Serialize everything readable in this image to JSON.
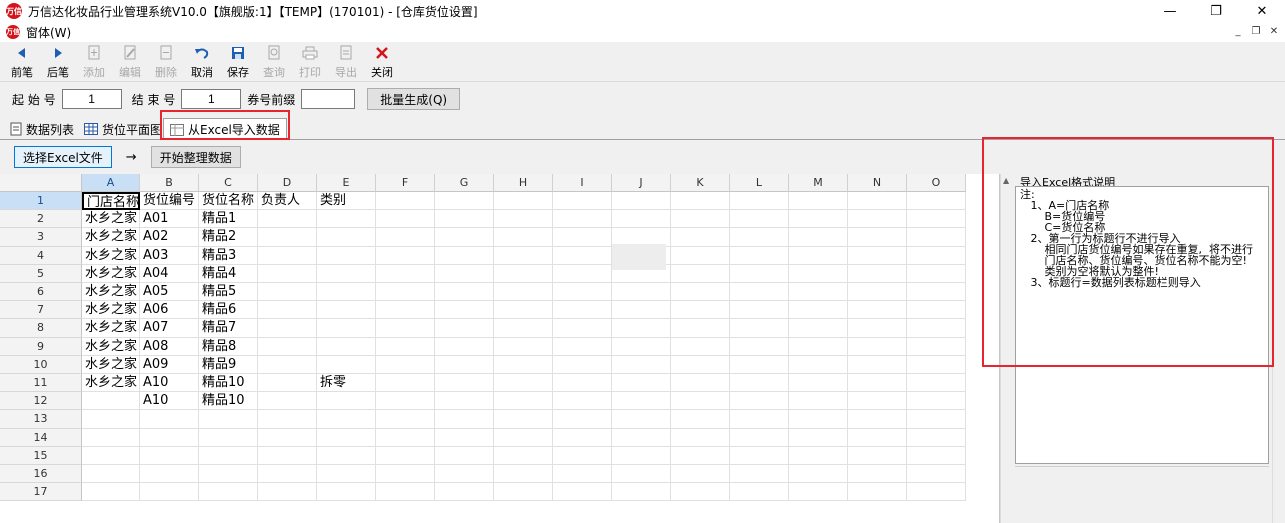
{
  "window": {
    "title": "万信达化妆品行业管理系统V10.0【旗舰版:1】【TEMP】(170101) - [仓库货位设置]",
    "logo": "万信",
    "controls": [
      "—",
      "❐",
      "✕"
    ]
  },
  "menubar": {
    "window_menu": "窗体(W)",
    "mdi_controls": [
      "_",
      "❐",
      "✕"
    ]
  },
  "toolbar": [
    {
      "label": "前笔",
      "icon": "arrow-up",
      "enabled": true
    },
    {
      "label": "后笔",
      "icon": "arrow-down",
      "enabled": true
    },
    {
      "label": "添加",
      "icon": "add-doc",
      "enabled": false
    },
    {
      "label": "编辑",
      "icon": "edit-doc",
      "enabled": false
    },
    {
      "label": "删除",
      "icon": "delete-doc",
      "enabled": false
    },
    {
      "label": "取消",
      "icon": "undo",
      "enabled": true
    },
    {
      "label": "保存",
      "icon": "save",
      "enabled": true
    },
    {
      "label": "查询",
      "icon": "query",
      "enabled": false
    },
    {
      "label": "打印",
      "icon": "print",
      "enabled": false
    },
    {
      "label": "导出",
      "icon": "export",
      "enabled": false
    },
    {
      "label": "关闭",
      "icon": "close",
      "enabled": true
    }
  ],
  "params": {
    "start_label": "起 始 号",
    "start_value": "1",
    "end_label": "结 束 号",
    "end_value": "1",
    "prefix_label": "券号前缀",
    "prefix_value": "",
    "generate_label": "批量生成(Q)"
  },
  "tabs": [
    {
      "label": "数据列表",
      "icon": "doc"
    },
    {
      "label": "货位平面图",
      "icon": "grid"
    },
    {
      "label": "从Excel导入数据",
      "icon": "excel",
      "active": true
    }
  ],
  "actions": {
    "select_file": "选择Excel文件",
    "arrow": "→",
    "start": "开始整理数据"
  },
  "sheet": {
    "columns": [
      "A",
      "B",
      "C",
      "D",
      "E",
      "F",
      "G",
      "H",
      "I",
      "J",
      "K",
      "L",
      "M",
      "N",
      "O"
    ],
    "rows": [
      "1",
      "2",
      "3",
      "4",
      "5",
      "6",
      "7",
      "8",
      "9",
      "10",
      "11",
      "12",
      "13",
      "14",
      "15",
      "16",
      "17"
    ],
    "cells": [
      [
        "门店名称",
        "货位编号",
        "货位名称",
        "负责人",
        "类别"
      ],
      [
        "水乡之家",
        "A01",
        "精品1",
        "",
        ""
      ],
      [
        "水乡之家",
        "A02",
        "精品2",
        "",
        ""
      ],
      [
        "水乡之家",
        "A03",
        "精品3",
        "",
        ""
      ],
      [
        "水乡之家",
        "A04",
        "精品4",
        "",
        ""
      ],
      [
        "水乡之家",
        "A05",
        "精品5",
        "",
        ""
      ],
      [
        "水乡之家",
        "A06",
        "精品6",
        "",
        ""
      ],
      [
        "水乡之家",
        "A07",
        "精品7",
        "",
        ""
      ],
      [
        "水乡之家",
        "A08",
        "精品8",
        "",
        ""
      ],
      [
        "水乡之家",
        "A09",
        "精品9",
        "",
        ""
      ],
      [
        "水乡之家",
        "A10",
        "精品10",
        "",
        "拆零"
      ],
      [
        "",
        "A10",
        "精品10",
        "",
        ""
      ]
    ]
  },
  "instructions": {
    "title": "导入Excel格式说明",
    "lines": [
      "注:",
      "   1、A=门店名称",
      "       B=货位编号",
      "       C=货位名称",
      "",
      "   2、第一行为标题行不进行导入",
      "       相同门店货位编号如果存在重复,  将不进行",
      "       门店名称、货位编号、货位名称不能为空!",
      "       类别为空将默认为整件!",
      "",
      "   3、标题行=数据列表标题栏则导入"
    ]
  }
}
